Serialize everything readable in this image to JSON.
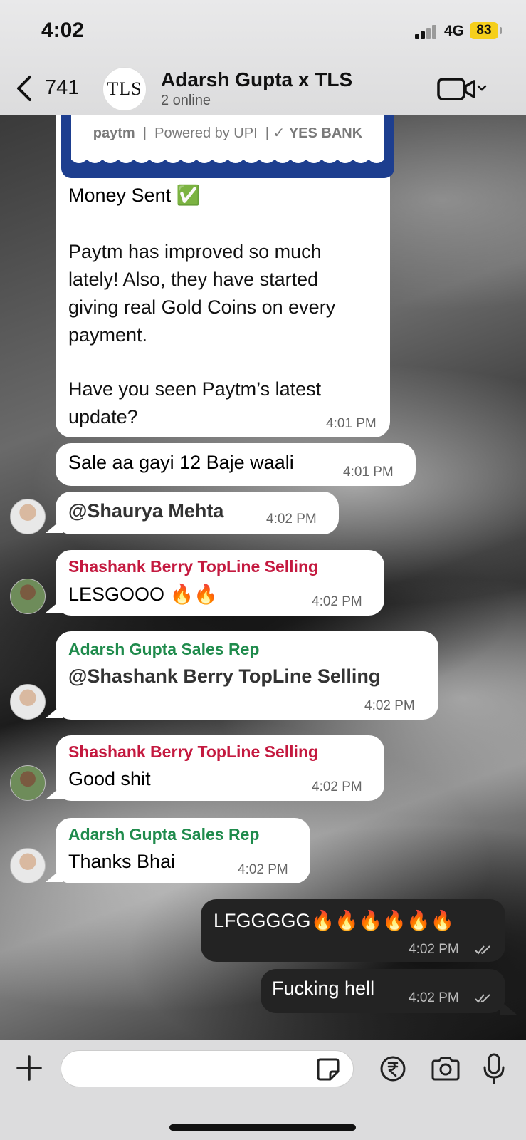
{
  "status_bar": {
    "time": "4:02",
    "network": "4G",
    "battery": "83"
  },
  "header": {
    "back_count": "741",
    "group_avatar_text": "TLS",
    "title": "Adarsh Gupta x TLS",
    "subtitle": "2 online"
  },
  "messages": {
    "m1": {
      "card_logos": [
        "paytm",
        "Powered by UPI",
        "YES BANK"
      ],
      "line1": "Money Sent ✅",
      "para1": [
        "Paytm has improved so much",
        "lately! Also, they have started",
        "giving real Gold Coins on every",
        "payment."
      ],
      "para2": [
        "Have you seen Paytm’s latest",
        "update?"
      ],
      "time": "4:01 PM"
    },
    "m2": {
      "text": "Sale  aa gayi 12 Baje waali",
      "time": "4:01 PM"
    },
    "m3": {
      "text": "@Shaurya Mehta",
      "time": "4:02 PM"
    },
    "m4": {
      "sender": "Shashank Berry TopLine Selling",
      "text": "LESGOOO 🔥🔥",
      "time": "4:02 PM"
    },
    "m5": {
      "sender": "Adarsh Gupta Sales Rep",
      "text": "@Shashank Berry TopLine Selling",
      "time": "4:02 PM"
    },
    "m6": {
      "sender": "Shashank Berry TopLine Selling",
      "text": "Good shit",
      "time": "4:02 PM"
    },
    "m7": {
      "sender": "Adarsh Gupta Sales Rep",
      "text": "Thanks Bhai",
      "time": "4:02 PM"
    },
    "m8": {
      "text": "LFGGGGG🔥🔥🔥🔥🔥🔥",
      "time": "4:02 PM"
    },
    "m9": {
      "text": "Fucking hell",
      "time": "4:02 PM"
    }
  },
  "colors": {
    "sender_red": "#c4193f",
    "sender_green": "#1f8b4c",
    "paytm_blue": "#1d3e8f",
    "battery_yellow": "#f5cf1c"
  },
  "icons": [
    "back-chevron",
    "video-call",
    "plus",
    "sticker",
    "rupee",
    "camera",
    "microphone"
  ]
}
